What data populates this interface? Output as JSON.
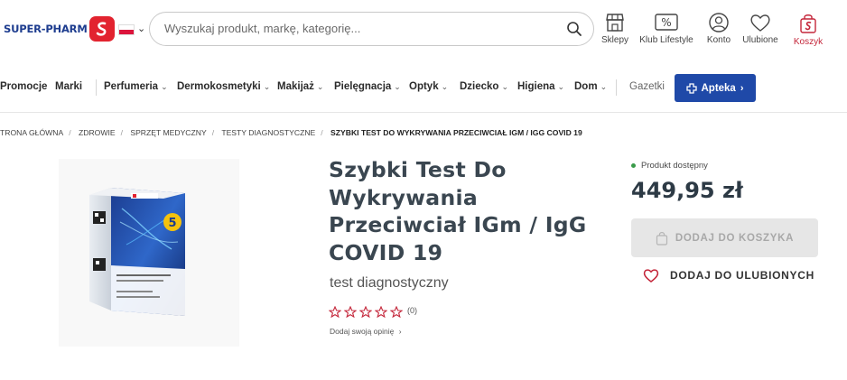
{
  "header": {
    "logo_text": "SUPER-PHARM",
    "search_placeholder": "Wyszukaj produkt, markę, kategorię...",
    "icons": [
      {
        "name": "store-icon",
        "label": "Sklepy"
      },
      {
        "name": "percent-tag-icon",
        "label": "Klub Lifestyle"
      },
      {
        "name": "user-icon",
        "label": "Konto"
      },
      {
        "name": "heart-icon",
        "label": "Ulubione"
      },
      {
        "name": "cart-icon",
        "label": "Koszyk"
      }
    ]
  },
  "nav": {
    "items": [
      "Promocje",
      "Marki",
      "Perfumeria",
      "Dermokosmetyki",
      "Makijaż",
      "Pielęgnacja",
      "Optyk",
      "Dziecko",
      "Higiena",
      "Dom"
    ],
    "gazetki": "Gazetki",
    "apteka": "Apteka"
  },
  "breadcrumb": [
    "TRONA GŁÓWNA",
    "ZDROWIE",
    "SPRZĘT MEDYCZNY",
    "TESTY DIAGNOSTYCZNE",
    "SZYBKI TEST DO WYKRYWANIA PRZECIWCIAŁ IGM / IGG COVID 19"
  ],
  "product": {
    "title_lines": [
      "Szybki Test Do",
      "Wykrywania",
      "Przeciwciał IGm / IgG",
      "COVID 19"
    ],
    "subtitle": "test diagnostyczny",
    "rating": 0,
    "rating_count": "(0)",
    "add_review": "Dodaj swoją opinię",
    "availability": "Produkt dostępny",
    "price": "449,95 zł",
    "add_to_cart": "DODAJ DO KOSZYKA",
    "add_to_favorites": "DODAJ DO ULUBIONYCH"
  },
  "colors": {
    "brand_red": "#e2232f",
    "brand_blue": "#1f49a8",
    "star_pink": "#c4263a",
    "available_green": "#3a9b4a"
  }
}
